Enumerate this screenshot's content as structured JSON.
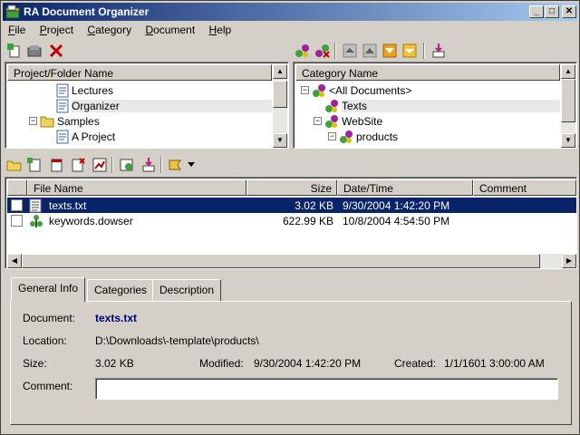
{
  "window": {
    "title": "RA Document Organizer"
  },
  "caption_buttons": {
    "minimize": "_",
    "maximize": "□",
    "close": "✕"
  },
  "menu": [
    {
      "label": "File",
      "mnemonic": "F",
      "rest": "ile"
    },
    {
      "label": "Project",
      "mnemonic": "P",
      "rest": "roject"
    },
    {
      "label": "Category",
      "mnemonic": "C",
      "rest": "ategory"
    },
    {
      "label": "Document",
      "mnemonic": "D",
      "rest": "ocument"
    },
    {
      "label": "Help",
      "mnemonic": "H",
      "rest": "elp"
    }
  ],
  "project_tree": {
    "header": "Project/Folder Name",
    "items": [
      {
        "label": "Lectures",
        "selected": false
      },
      {
        "label": "Organizer",
        "selected": true
      },
      {
        "label": "Samples",
        "expander": "−",
        "selected": false
      },
      {
        "label": "A Project",
        "selected": false
      }
    ]
  },
  "category_tree": {
    "header": "Category Name",
    "items": [
      {
        "label": "<All Documents>",
        "expander": "−",
        "selected": false
      },
      {
        "label": "Texts",
        "selected": true
      },
      {
        "label": "WebSite",
        "expander": "−",
        "selected": false
      },
      {
        "label": "products",
        "expander": "−",
        "selected": false
      }
    ]
  },
  "file_list": {
    "columns": [
      "File Name",
      "Size",
      "Date/Time",
      "Comment"
    ],
    "rows": [
      {
        "name": "texts.txt",
        "size": "3.02 KB",
        "datetime": "9/30/2004 1:42:20 PM",
        "comment": "",
        "selected": true
      },
      {
        "name": "keywords.dowser",
        "size": "622.99 KB",
        "datetime": "10/8/2004 4:54:50 PM",
        "comment": "",
        "selected": false
      }
    ]
  },
  "tabs": [
    "General Info",
    "Categories",
    "Description"
  ],
  "general_info": {
    "document_label": "Document:",
    "document_value": "texts.txt",
    "location_label": "Location:",
    "location_value": "D:\\Downloads\\-template\\products\\",
    "size_label": "Size:",
    "size_value": "3.02 KB",
    "modified_label": "Modified:",
    "modified_value": "9/30/2004 1:42:20 PM",
    "created_label": "Created:",
    "created_value": "1/1/1601 3:00:00 AM",
    "comment_label": "Comment:",
    "comment_value": ""
  },
  "colors": {
    "title_start": "#0a246a",
    "title_end": "#a6caf0",
    "selection": "#0a246a",
    "link_blue": "#000080"
  },
  "icons": [
    "app-icon",
    "new-project-icon",
    "folder-icon",
    "delete-icon",
    "category-node-icon",
    "document-icon",
    "move-up-icon",
    "move-down-icon",
    "import-icon",
    "dropdown-icon"
  ]
}
